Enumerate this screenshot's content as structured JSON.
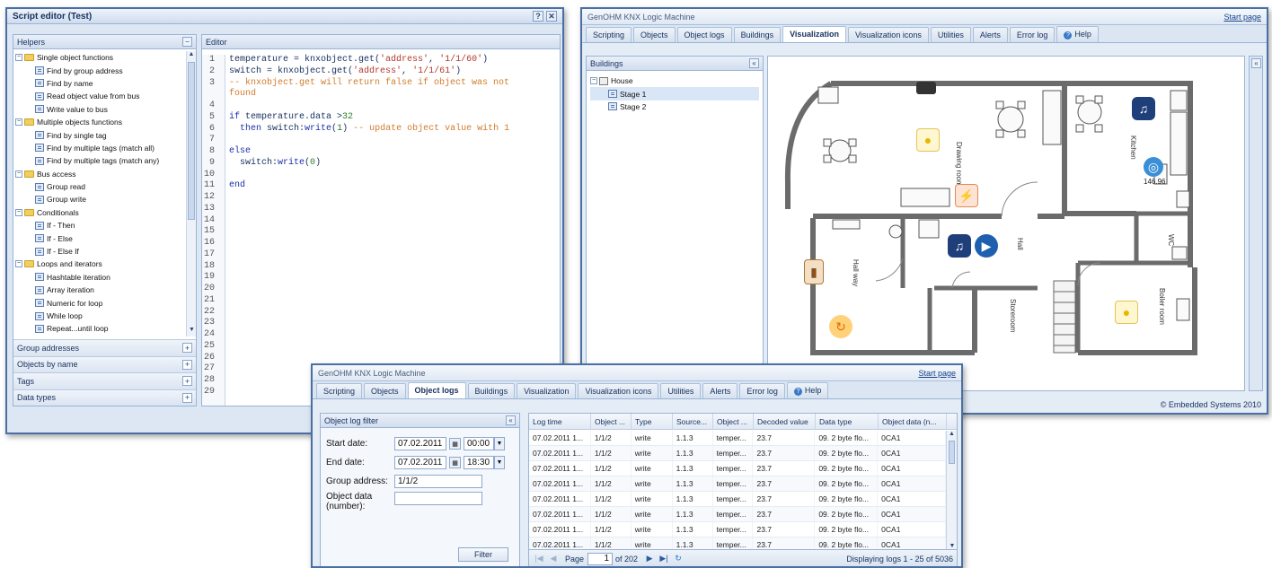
{
  "script_editor": {
    "title": "Script editor (Test)",
    "help_btn": "?",
    "close_btn": "✕",
    "helpers_title": "Helpers",
    "editor_title": "Editor",
    "tree": [
      {
        "label": "Single object functions",
        "type": "folder"
      },
      {
        "label": "Find by group address",
        "type": "leaf"
      },
      {
        "label": "Find by name",
        "type": "leaf"
      },
      {
        "label": "Read object value from bus",
        "type": "leaf"
      },
      {
        "label": "Write value to bus",
        "type": "leaf"
      },
      {
        "label": "Multiple objects functions",
        "type": "folder"
      },
      {
        "label": "Find by single tag",
        "type": "leaf"
      },
      {
        "label": "Find by multiple tags (match all)",
        "type": "leaf"
      },
      {
        "label": "Find by multiple tags (match any)",
        "type": "leaf"
      },
      {
        "label": "Bus access",
        "type": "folder"
      },
      {
        "label": "Group read",
        "type": "leaf"
      },
      {
        "label": "Group write",
        "type": "leaf"
      },
      {
        "label": "Conditionals",
        "type": "folder"
      },
      {
        "label": "If - Then",
        "type": "leaf"
      },
      {
        "label": "If - Else",
        "type": "leaf"
      },
      {
        "label": "If - Else If",
        "type": "leaf"
      },
      {
        "label": "Loops and iterators",
        "type": "folder"
      },
      {
        "label": "Hashtable iteration",
        "type": "leaf"
      },
      {
        "label": "Array iteration",
        "type": "leaf"
      },
      {
        "label": "Numeric for loop",
        "type": "leaf"
      },
      {
        "label": "While loop",
        "type": "leaf"
      },
      {
        "label": "Repeat...until loop",
        "type": "leaf"
      }
    ],
    "accordion": [
      "Group addresses",
      "Objects by name",
      "Tags",
      "Data types"
    ],
    "line_numbers": [
      "1",
      "2",
      "3",
      "",
      "4",
      "5",
      "6",
      "7",
      "8",
      "9",
      "10",
      "11",
      "12",
      "13",
      "14",
      "15",
      "16",
      "17",
      "18",
      "19",
      "20",
      "21",
      "22",
      "23",
      "24",
      "25",
      "26",
      "27",
      "28",
      "29"
    ],
    "code": {
      "l1_a": "temperature = knxobject.get(",
      "l1_b": "'address'",
      "l1_c": ", ",
      "l1_d": "'1/1/60'",
      "l1_e": ")",
      "l2_a": "switch = knxobject.get(",
      "l2_b": "'address'",
      "l2_c": ", ",
      "l2_d": "'1/1/61'",
      "l2_e": ")",
      "l3": "-- knxobject.get will return false if object was not",
      "l3b": "found",
      "l5_a": "if",
      "l5_b": " temperature.data >",
      "l5_c": "32",
      "l6_a": "  then",
      "l6_b": " switch:",
      "l6_c": "write",
      "l6_d": "(",
      "l6_e": "1",
      "l6_f": ") ",
      "l6_g": "-- update object value with 1",
      "l8": "else",
      "l9_a": "  switch:",
      "l9_b": "write",
      "l9_c": "(",
      "l9_d": "0",
      "l9_e": ")",
      "l11": "end"
    }
  },
  "visualization": {
    "title": "GenOHM KNX Logic Machine",
    "start_page": "Start page",
    "tabs": [
      "Scripting",
      "Objects",
      "Object logs",
      "Buildings",
      "Visualization",
      "Visualization icons",
      "Utilities",
      "Alerts",
      "Error log",
      "Help"
    ],
    "active_tab": "Visualization",
    "buildings_title": "Buildings",
    "tree": [
      {
        "label": "House",
        "level": 0
      },
      {
        "label": "Stage 1",
        "level": 1
      },
      {
        "label": "Stage 2",
        "level": 1
      }
    ],
    "rooms": {
      "drawing": "Drawing room",
      "kitchen": "Kitchen",
      "hall": "Hall",
      "hallway": "Hall way",
      "storeroom": "Storeroom",
      "boiler": "Boiler room",
      "wc": "WC"
    },
    "temperature_value": "146.96",
    "footer": "© Embedded Systems 2010"
  },
  "object_logs": {
    "title": "GenOHM KNX Logic Machine",
    "start_page": "Start page",
    "tabs": [
      "Scripting",
      "Objects",
      "Object logs",
      "Buildings",
      "Visualization",
      "Visualization icons",
      "Utilities",
      "Alerts",
      "Error log",
      "Help"
    ],
    "active_tab": "Object logs",
    "filter": {
      "title": "Object log filter",
      "start_label": "Start date:",
      "start_date": "07.02.2011",
      "start_time": "00:00",
      "end_label": "End date:",
      "end_date": "07.02.2011",
      "end_time": "18:30",
      "group_label": "Group address:",
      "group_value": "1/1/2",
      "objdata_label": "Object data (number):",
      "objdata_value": "",
      "filter_btn": "Filter"
    },
    "columns": [
      "Log time",
      "Object ...",
      "Type",
      "Source...",
      "Object ...",
      "Decoded value",
      "Data type",
      "Object data (n..."
    ],
    "rows": [
      [
        "07.02.2011 1...",
        "1/1/2",
        "write",
        "1.1.3",
        "temper...",
        "23.7",
        "09. 2 byte flo...",
        "0CA1"
      ],
      [
        "07.02.2011 1...",
        "1/1/2",
        "write",
        "1.1.3",
        "temper...",
        "23.7",
        "09. 2 byte flo...",
        "0CA1"
      ],
      [
        "07.02.2011 1...",
        "1/1/2",
        "write",
        "1.1.3",
        "temper...",
        "23.7",
        "09. 2 byte flo...",
        "0CA1"
      ],
      [
        "07.02.2011 1...",
        "1/1/2",
        "write",
        "1.1.3",
        "temper...",
        "23.7",
        "09. 2 byte flo...",
        "0CA1"
      ],
      [
        "07.02.2011 1...",
        "1/1/2",
        "write",
        "1.1.3",
        "temper...",
        "23.7",
        "09. 2 byte flo...",
        "0CA1"
      ],
      [
        "07.02.2011 1...",
        "1/1/2",
        "write",
        "1.1.3",
        "temper...",
        "23.7",
        "09. 2 byte flo...",
        "0CA1"
      ],
      [
        "07.02.2011 1...",
        "1/1/2",
        "write",
        "1.1.3",
        "temper...",
        "23.7",
        "09. 2 byte flo...",
        "0CA1"
      ],
      [
        "07.02.2011 1...",
        "1/1/2",
        "write",
        "1.1.3",
        "temper...",
        "23.7",
        "09. 2 byte flo...",
        "0CA1"
      ]
    ],
    "pager": {
      "page_label": "Page",
      "page_value": "1",
      "of_label": "of 202",
      "status": "Displaying logs 1 - 25 of 5036"
    }
  }
}
